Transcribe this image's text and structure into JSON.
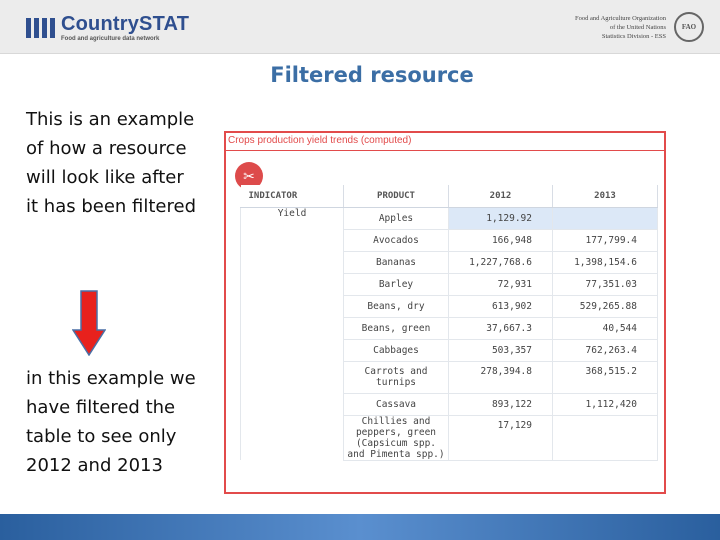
{
  "header": {
    "logo_name": "CountrySTAT",
    "logo_tagline": "Food and agriculture data network",
    "org_line1": "Food and Agriculture Organization",
    "org_line2": "of the United Nations",
    "org_line3": "Statistics Division - ESS",
    "emblem_text": "FAO"
  },
  "slide": {
    "title": "Filtered resource",
    "text1": "This is an example of how a resource will look like after it has been filtered",
    "text2": "in this example we have filtered the table to see only 2012 and 2013"
  },
  "screenshot": {
    "title": "Crops production yield trends (computed)",
    "filter_icon": "filter-icon",
    "columns": [
      "INDICATOR",
      "PRODUCT",
      "2012",
      "2013"
    ],
    "indicator": "Yield",
    "rows": [
      {
        "product": "Apples",
        "y2012": "1,129.92",
        "y2013": ""
      },
      {
        "product": "Avocados",
        "y2012": "166,948",
        "y2013": "177,799.4"
      },
      {
        "product": "Bananas",
        "y2012": "1,227,768.6",
        "y2013": "1,398,154.6"
      },
      {
        "product": "Barley",
        "y2012": "72,931",
        "y2013": "77,351.03"
      },
      {
        "product": "Beans, dry",
        "y2012": "613,902",
        "y2013": "529,265.88"
      },
      {
        "product": "Beans, green",
        "y2012": "37,667.3",
        "y2013": "40,544"
      },
      {
        "product": "Cabbages",
        "y2012": "503,357",
        "y2013": "762,263.4"
      },
      {
        "product": "Carrots and turnips",
        "y2012": "278,394.8",
        "y2013": "368,515.2"
      },
      {
        "product": "Cassava",
        "y2012": "893,122",
        "y2013": "1,112,420"
      },
      {
        "product": "Chillies and peppers, green (Capsicum spp. and Pimenta spp.)",
        "y2012": "17,129",
        "y2013": ""
      }
    ]
  },
  "colors": {
    "title_blue": "#3b6ea5",
    "accent_red": "#e24b4b",
    "selected_cell": "#dce8f7"
  }
}
